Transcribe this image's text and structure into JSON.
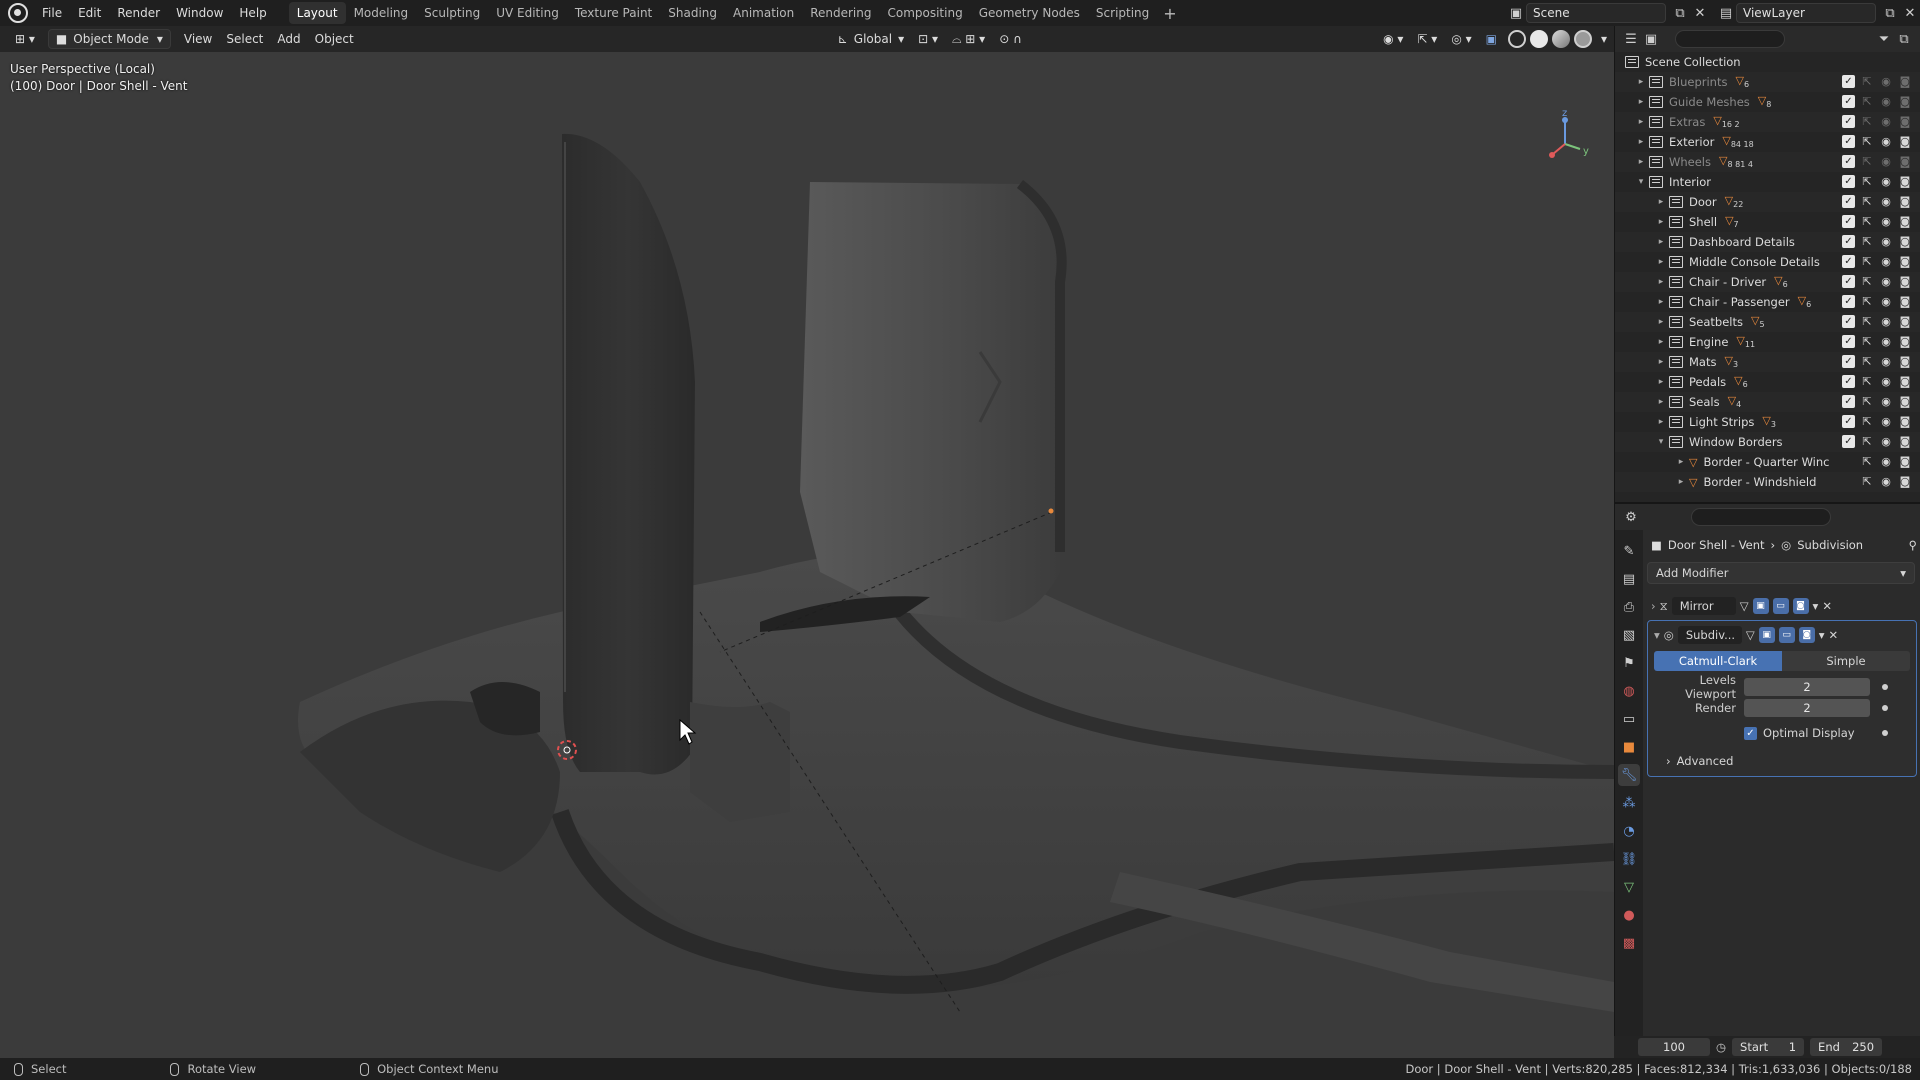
{
  "topbar": {
    "menus": [
      "File",
      "Edit",
      "Render",
      "Window",
      "Help"
    ],
    "workspaces": [
      "Layout",
      "Modeling",
      "Sculpting",
      "UV Editing",
      "Texture Paint",
      "Shading",
      "Animation",
      "Rendering",
      "Compositing",
      "Geometry Nodes",
      "Scripting"
    ],
    "active_workspace": "Layout",
    "add_tab": "+",
    "scene": "Scene",
    "view_layer": "ViewLayer"
  },
  "viewport_header": {
    "mode": "Object Mode",
    "menus": [
      "View",
      "Select",
      "Add",
      "Object"
    ],
    "orientation": "Global"
  },
  "viewport": {
    "perspective": "User Perspective (Local)",
    "object_info": "(100) Door | Door Shell - Vent",
    "gizmo_axes": [
      "z",
      "y"
    ],
    "colors": {
      "background": "#3b3b3b",
      "mesh": "#555555",
      "origin": "#e8893c",
      "cursor": "#e05050"
    }
  },
  "outliner": {
    "root": "Scene Collection",
    "rows": [
      {
        "name": "Blueprints",
        "level": 1,
        "expand": "▸",
        "dim": true,
        "badge": "6"
      },
      {
        "name": "Guide Meshes",
        "level": 1,
        "expand": "▸",
        "dim": true,
        "badge": "8"
      },
      {
        "name": "Extras",
        "level": 1,
        "expand": "▸",
        "dim": true,
        "badge": "16 2"
      },
      {
        "name": "Exterior",
        "level": 1,
        "expand": "▸",
        "dim": false,
        "badge": "84 18"
      },
      {
        "name": "Wheels",
        "level": 1,
        "expand": "▸",
        "dim": true,
        "badge": "8 81 4"
      },
      {
        "name": "Interior",
        "level": 1,
        "expand": "▾",
        "dim": false,
        "badge": ""
      },
      {
        "name": "Door",
        "level": 2,
        "expand": "▸",
        "dim": false,
        "badge": "22"
      },
      {
        "name": "Shell",
        "level": 2,
        "expand": "▸",
        "dim": false,
        "badge": "7"
      },
      {
        "name": "Dashboard Details",
        "level": 2,
        "expand": "▸",
        "dim": false,
        "badge": ""
      },
      {
        "name": "Middle Console Details",
        "level": 2,
        "expand": "▸",
        "dim": false,
        "badge": ""
      },
      {
        "name": "Chair - Driver",
        "level": 2,
        "expand": "▸",
        "dim": false,
        "badge": "6"
      },
      {
        "name": "Chair - Passenger",
        "level": 2,
        "expand": "▸",
        "dim": false,
        "badge": "6"
      },
      {
        "name": "Seatbelts",
        "level": 2,
        "expand": "▸",
        "dim": false,
        "badge": "5"
      },
      {
        "name": "Engine",
        "level": 2,
        "expand": "▸",
        "dim": false,
        "badge": "11"
      },
      {
        "name": "Mats",
        "level": 2,
        "expand": "▸",
        "dim": false,
        "badge": "3"
      },
      {
        "name": "Pedals",
        "level": 2,
        "expand": "▸",
        "dim": false,
        "badge": "6"
      },
      {
        "name": "Seals",
        "level": 2,
        "expand": "▸",
        "dim": false,
        "badge": "4"
      },
      {
        "name": "Light Strips",
        "level": 2,
        "expand": "▸",
        "dim": false,
        "badge": "3"
      },
      {
        "name": "Window Borders",
        "level": 2,
        "expand": "▾",
        "dim": false,
        "badge": ""
      },
      {
        "name": "Border - Quarter Winc",
        "level": 3,
        "expand": "▸",
        "dim": false,
        "badge": "",
        "mesh": true
      },
      {
        "name": "Border - Windshield",
        "level": 3,
        "expand": "▸",
        "dim": false,
        "badge": "",
        "mesh": true
      }
    ]
  },
  "properties": {
    "breadcrumb_object": "Door Shell - Vent",
    "breadcrumb_modifier": "Subdivision",
    "add_modifier": "Add Modifier",
    "modifiers": [
      {
        "name": "Mirror",
        "expanded": false
      },
      {
        "name": "Subdiv...",
        "expanded": true
      }
    ],
    "subdivision": {
      "algorithms": [
        "Catmull-Clark",
        "Simple"
      ],
      "active_algorithm": "Catmull-Clark",
      "levels_viewport_label": "Levels Viewport",
      "levels_viewport": "2",
      "render_label": "Render",
      "render": "2",
      "optimal_display_label": "Optimal Display",
      "optimal_display": true,
      "advanced_label": "Advanced"
    }
  },
  "timeline": {
    "current_frame": "100",
    "start_label": "Start",
    "start": "1",
    "end_label": "End",
    "end": "250"
  },
  "statusbar": {
    "select": "Select",
    "rotate": "Rotate View",
    "context": "Object Context Menu",
    "stats": "Door | Door Shell - Vent | Verts:820,285 | Faces:812,334 | Tris:1,633,036 | Objects:0/188"
  }
}
